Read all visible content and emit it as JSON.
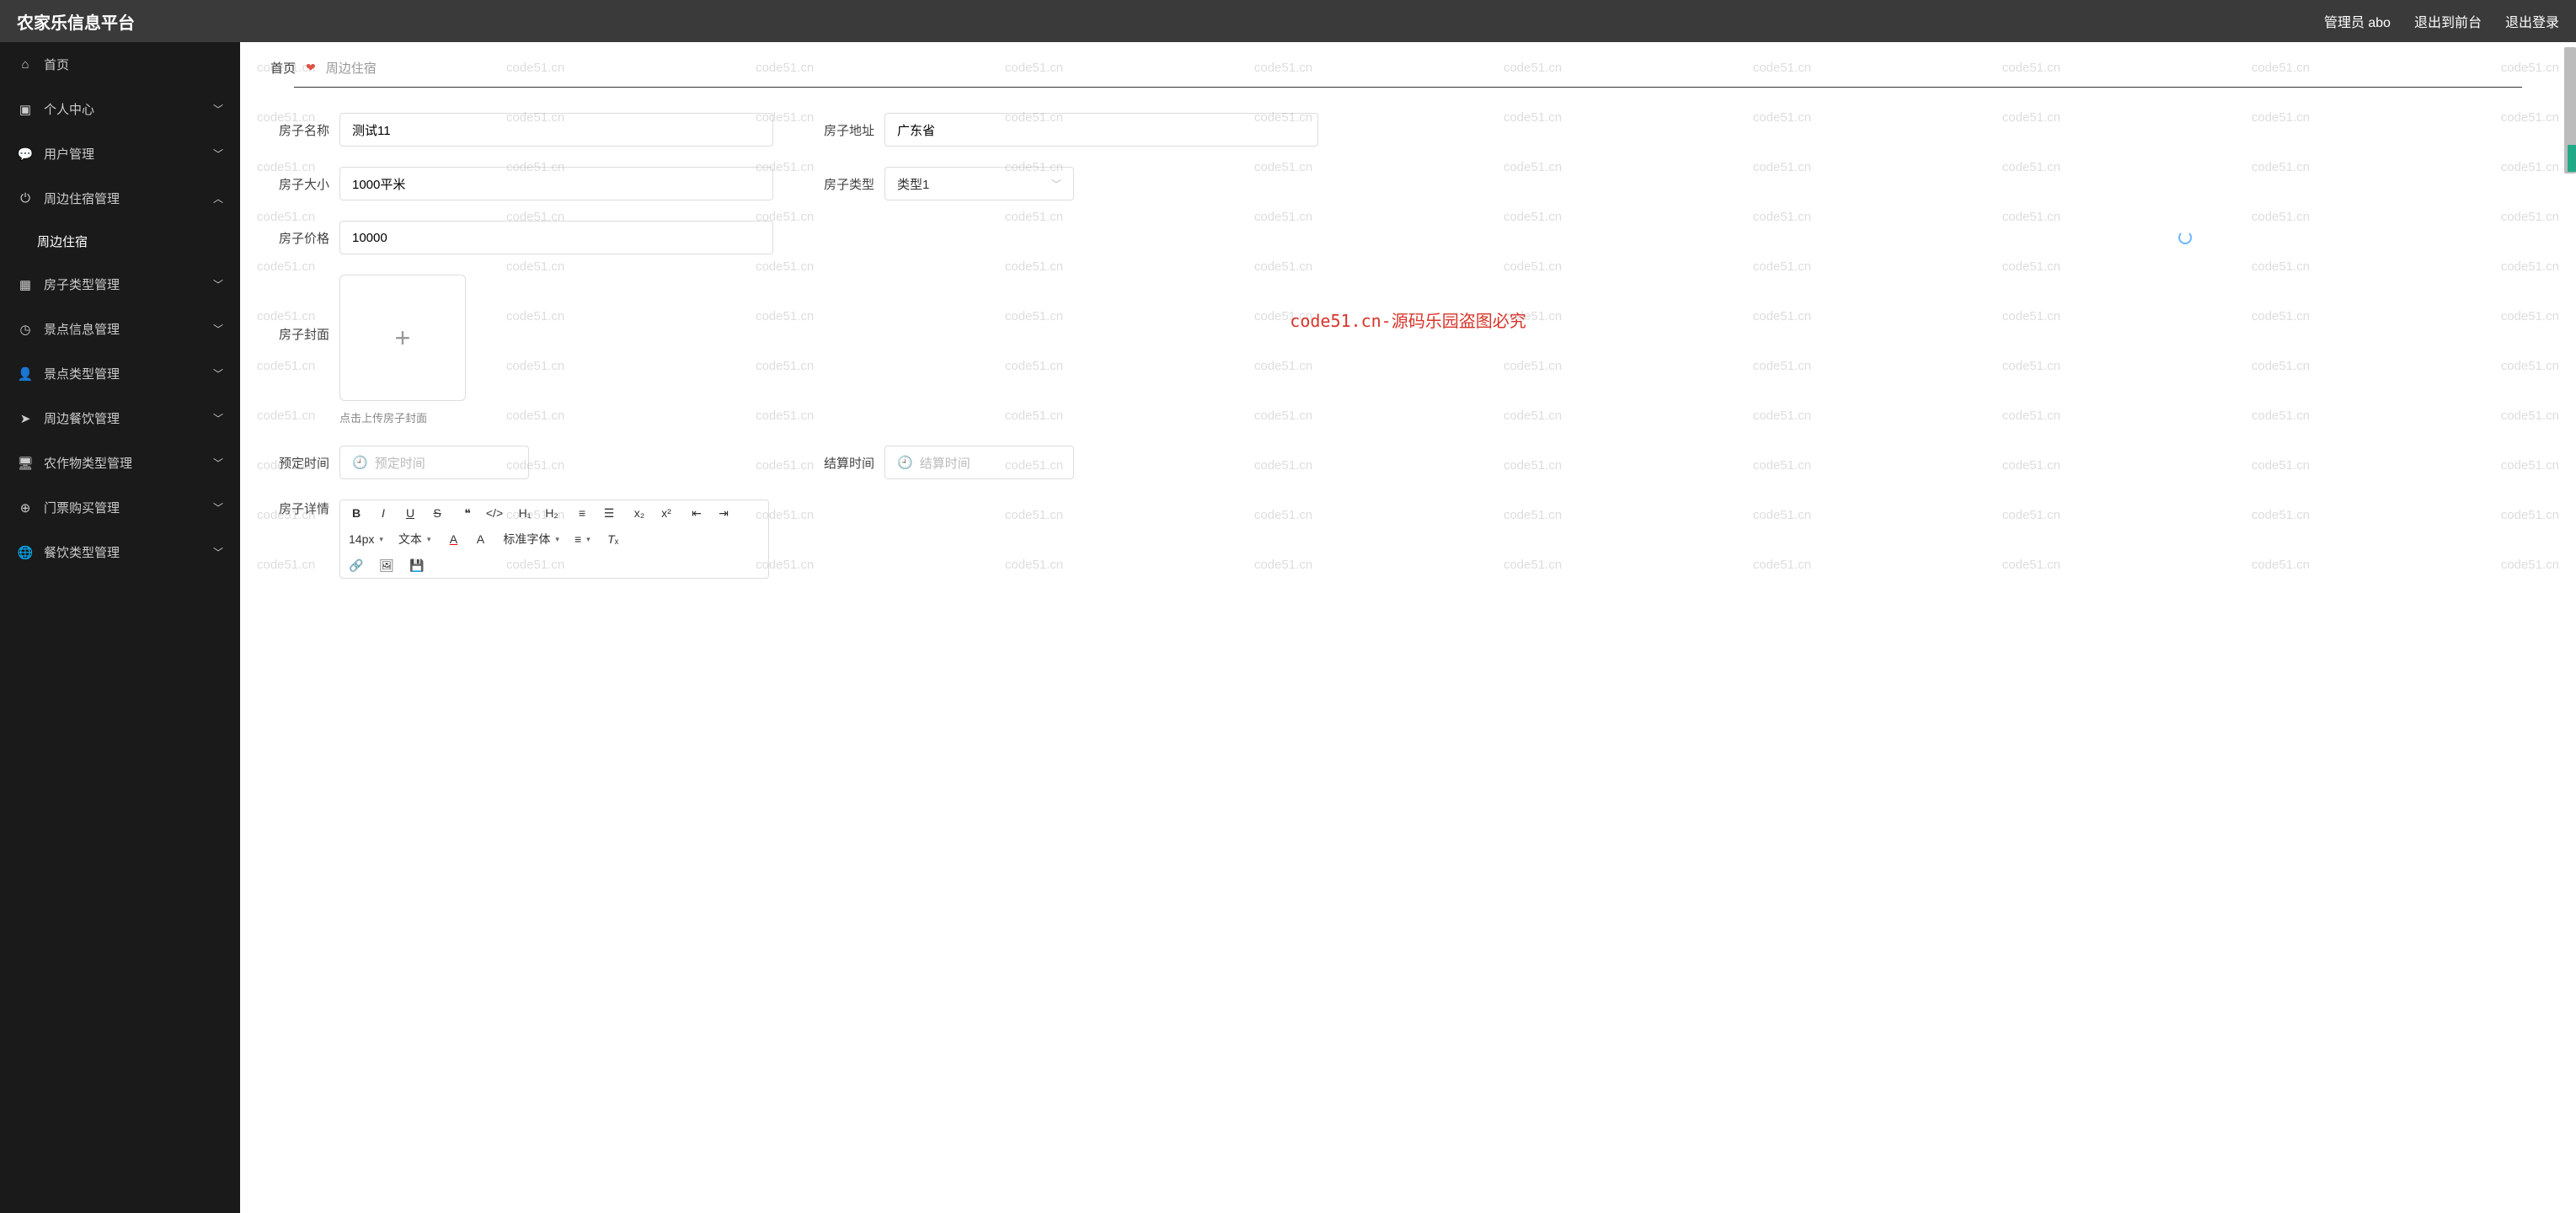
{
  "brand": "农家乐信息平台",
  "topbar": {
    "admin": "管理员 abo",
    "exit_front": "退出到前台",
    "logout": "退出登录"
  },
  "sidebar": {
    "items": [
      {
        "icon": "home",
        "label": "首页",
        "expandable": false
      },
      {
        "icon": "user",
        "label": "个人中心",
        "expandable": true
      },
      {
        "icon": "chat",
        "label": "用户管理",
        "expandable": true
      },
      {
        "icon": "power",
        "label": "周边住宿管理",
        "expandable": true,
        "open": true,
        "children": [
          {
            "label": "周边住宿"
          }
        ]
      },
      {
        "icon": "grid",
        "label": "房子类型管理",
        "expandable": true
      },
      {
        "icon": "clock",
        "label": "景点信息管理",
        "expandable": true
      },
      {
        "icon": "person",
        "label": "景点类型管理",
        "expandable": true
      },
      {
        "icon": "send",
        "label": "周边餐饮管理",
        "expandable": true
      },
      {
        "icon": "monitor",
        "label": "农作物类型管理",
        "expandable": true
      },
      {
        "icon": "target",
        "label": "门票购买管理",
        "expandable": true
      },
      {
        "icon": "globe",
        "label": "餐饮类型管理",
        "expandable": true
      }
    ]
  },
  "crumb": {
    "home": "首页",
    "current": "周边住宿"
  },
  "form": {
    "house_name": {
      "label": "房子名称",
      "value": "测试11"
    },
    "house_addr": {
      "label": "房子地址",
      "value": "广东省"
    },
    "house_size": {
      "label": "房子大小",
      "value": "1000平米"
    },
    "house_type": {
      "label": "房子类型",
      "value": "类型1"
    },
    "house_price": {
      "label": "房子价格",
      "value": "10000"
    },
    "house_cover": {
      "label": "房子封面",
      "hint": "点击上传房子封面"
    },
    "book_time": {
      "label": "预定时间",
      "placeholder": "预定时间"
    },
    "settle_time": {
      "label": "结算时间",
      "placeholder": "结算时间"
    },
    "house_detail": {
      "label": "房子详情"
    }
  },
  "editor": {
    "font_size": "14px",
    "text_menu": "文本",
    "font_family": "标准字体"
  },
  "watermark": {
    "text": "code51.cn",
    "center": "code51.cn-源码乐园盗图必究"
  }
}
